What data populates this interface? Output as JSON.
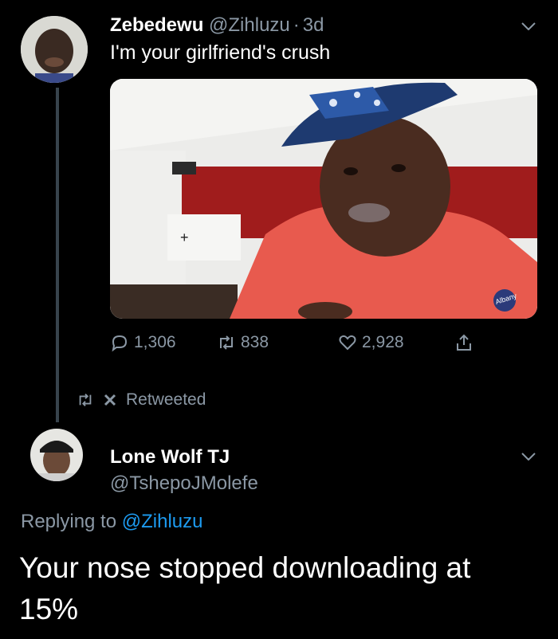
{
  "tweet": {
    "display_name": "Zebedewu",
    "handle": "@Zihluzu",
    "separator": "·",
    "age": "3d",
    "text": "I'm your girlfriend's crush",
    "image_text": "Albany",
    "actions": {
      "replies": "1,306",
      "retweets": "838",
      "likes": "2,928"
    }
  },
  "retweet_status": {
    "label": "Retweeted"
  },
  "reply": {
    "display_name": "Lone Wolf TJ",
    "handle": "@TshepoJMolefe",
    "replying_prefix": "Replying to",
    "replying_to": "@Zihluzu",
    "text_line1": "Your nose stopped downloading at",
    "text_line2": "15%"
  },
  "colors": {
    "background": "#000000",
    "muted": "#8b98a5",
    "link": "#1d9bf0",
    "thread_line": "#38444d"
  },
  "icons": [
    "chevron-down-icon",
    "reply-icon",
    "retweet-icon",
    "like-icon",
    "share-icon",
    "close-icon"
  ]
}
